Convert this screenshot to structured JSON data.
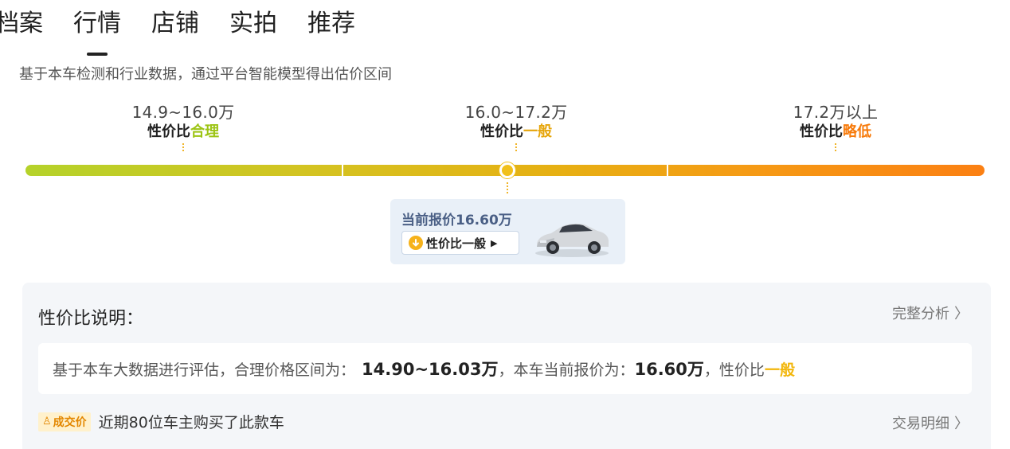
{
  "tabs": [
    {
      "label": "档案",
      "active": false
    },
    {
      "label": "行情",
      "active": true
    },
    {
      "label": "店铺",
      "active": false
    },
    {
      "label": "实拍",
      "active": false
    },
    {
      "label": "推荐",
      "active": false
    }
  ],
  "subtitle": "基于本车检测和行业数据，通过平台智能模型得出估价区间",
  "segments": [
    {
      "range": "14.9~16.0万",
      "prefix": "性价比",
      "verdict": "合理",
      "color": "#9cc414"
    },
    {
      "range": "16.0~17.2万",
      "prefix": "性价比",
      "verdict": "一般",
      "color": "#e6a50a"
    },
    {
      "range": "17.2万以上",
      "prefix": "性价比",
      "verdict": "略低",
      "color": "#f77a0a"
    }
  ],
  "current": {
    "price_text": "当前报价16.60万",
    "badge_label": "性价比一般",
    "badge_icon": "down-arrow-icon",
    "car_image": "car-thumbnail"
  },
  "explanation": {
    "title": "性价比说明：",
    "link": "完整分析",
    "text_prefix": "基于本车大数据进行评估，合理价格区间为：",
    "fair_range": "14.90~16.03万",
    "text_mid": "，本车当前报价为：",
    "current_price": "16.60万",
    "text_suffix": "，性价比",
    "verdict": "一般"
  },
  "deal": {
    "tag": "成交价",
    "tag_icon": "person-icon",
    "text": "近期80位车主购买了此款车",
    "link": "交易明细"
  },
  "colors": {
    "accent_green": "#9cc414",
    "accent_yellow": "#f2b60a",
    "accent_orange": "#f77a0a",
    "price_blue": "#4a5f85"
  }
}
